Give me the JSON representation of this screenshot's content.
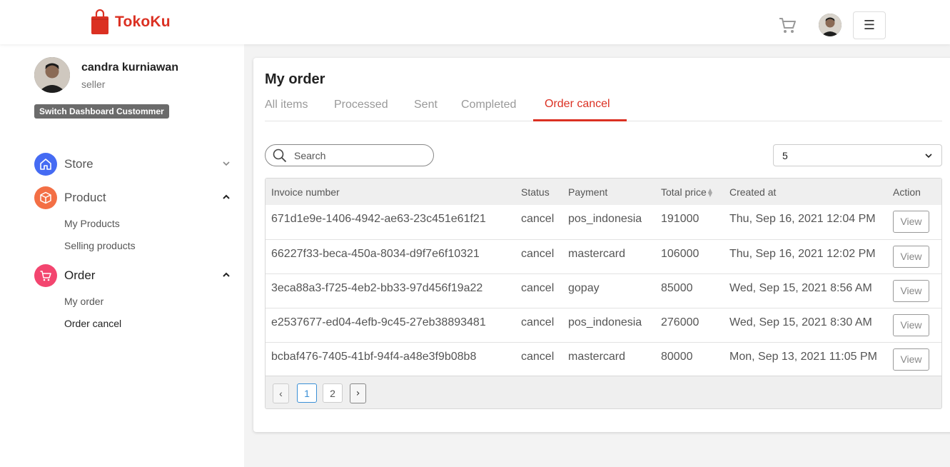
{
  "header": {
    "brand": "TokoKu",
    "menu_glyph": "☰",
    "icons": [
      "shopping-bag-icon",
      "cart-icon",
      "menu-icon"
    ],
    "brand_color": "#db3022"
  },
  "sidebar": {
    "profile": {
      "name": "candra kurniawan",
      "role": "seller",
      "switch_label": "Switch Dashboard Custommer"
    },
    "nav": [
      {
        "label": "Store",
        "icon": "home-icon",
        "color": "#456bf3",
        "expanded": false
      },
      {
        "label": "Product",
        "icon": "box-icon",
        "color": "#f36f45",
        "expanded": true,
        "children": [
          "My Products",
          "Selling products"
        ]
      },
      {
        "label": "Order",
        "icon": "cart-icon",
        "color": "#f3456f",
        "expanded": true,
        "children": [
          "My order",
          "Order cancel"
        ]
      }
    ]
  },
  "main": {
    "title": "My order",
    "tabs": [
      "All items",
      "Processed",
      "Sent",
      "Completed",
      "Order cancel"
    ],
    "active_tab": "Order cancel",
    "search": {
      "placeholder": "Search",
      "value": ""
    },
    "page_size": "5",
    "table": {
      "columns": [
        "Invoice number",
        "Status",
        "Payment",
        "Total price",
        "Created at",
        "Action"
      ],
      "rows": [
        [
          "671d1e9e-1406-4942-ae63-23c451e61f21",
          "cancel",
          "pos_indonesia",
          "191000",
          "Thu, Sep 16, 2021 12:04 PM",
          "View"
        ],
        [
          "66227f33-beca-450a-8034-d9f7e6f10321",
          "cancel",
          "mastercard",
          "106000",
          "Thu, Sep 16, 2021 12:02 PM",
          "View"
        ],
        [
          "3eca88a3-f725-4eb2-bb33-97d456f19a22",
          "cancel",
          "gopay",
          "85000",
          "Wed, Sep 15, 2021 8:56 AM",
          "View"
        ],
        [
          "e2537677-ed04-4efb-9c45-27eb38893481",
          "cancel",
          "pos_indonesia",
          "276000",
          "Wed, Sep 15, 2021 8:30 AM",
          "View"
        ],
        [
          "bcbaf476-7405-41bf-94f4-a48e3f9b08b8",
          "cancel",
          "mastercard",
          "80000",
          "Mon, Sep 13, 2021 11:05 PM",
          "View"
        ]
      ]
    },
    "pagination": {
      "prev": "‹",
      "pages": [
        "1",
        "2"
      ],
      "current": "1",
      "next": "›"
    }
  }
}
